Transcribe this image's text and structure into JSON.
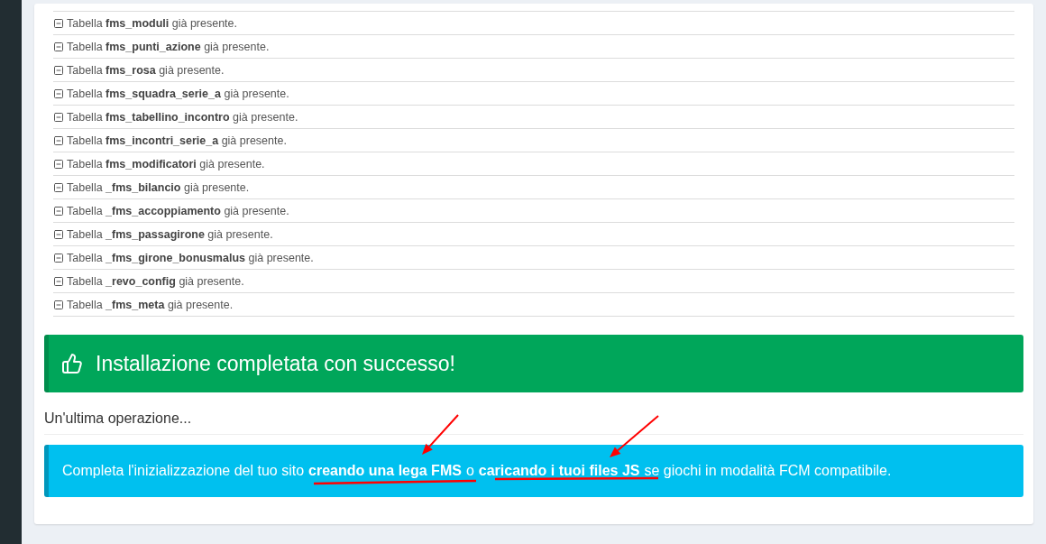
{
  "tables": [
    {
      "text": "Tabella **fms_moduli** già presente."
    },
    {
      "text": "Tabella **fms_punti_azione** già presente."
    },
    {
      "text": "Tabella **fms_rosa** già presente."
    },
    {
      "text": "Tabella **fms_squadra_serie_a** già presente."
    },
    {
      "text": "Tabella **fms_tabellino_incontro** già presente."
    },
    {
      "text": "Tabella **fms_incontri_serie_a** già presente."
    },
    {
      "text": "Tabella **fms_modificatori** già presente."
    },
    {
      "text": "Tabella **_fms_bilancio** già presente."
    },
    {
      "text": "Tabella **_fms_accoppiamento** già presente."
    },
    {
      "text": "Tabella **_fms_passagirone** già presente."
    },
    {
      "text": "Tabella **_fms_girone_bonusmalus** già presente."
    },
    {
      "text": "Tabella **_revo_config** già presente."
    },
    {
      "text": "Tabella **_fms_meta** già presente."
    }
  ],
  "success_alert": {
    "title": "Installazione completata con successo!"
  },
  "section_heading": "Un'ultima operazione...",
  "info_alert": {
    "parts": [
      {
        "kind": "text",
        "text": "Completa l'inizializzazione del tuo sito"
      },
      {
        "kind": "link",
        "text": "creando una lega FMS"
      },
      {
        "kind": "text",
        "text": "o"
      },
      {
        "kind": "link",
        "text": "caricando i tuoi files JS"
      },
      {
        "kind": "text",
        "text": "se giochi in modalità FCM compatibile."
      }
    ]
  }
}
